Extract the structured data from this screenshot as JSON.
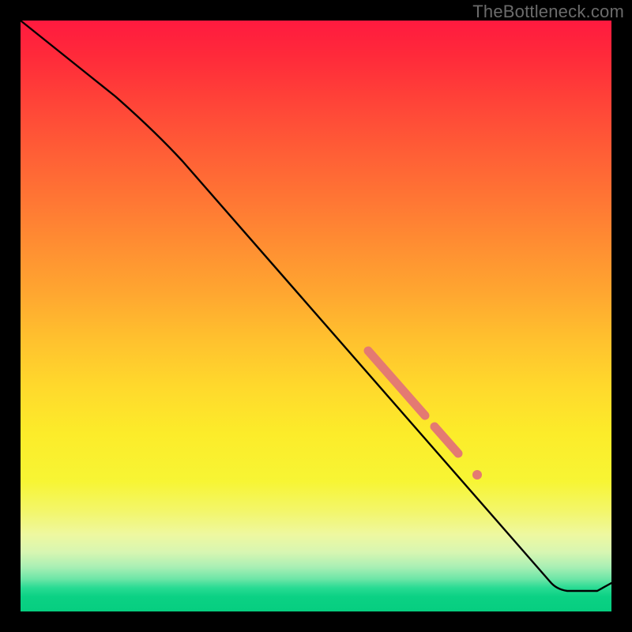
{
  "watermark": "TheBottleneck.com",
  "colors": {
    "highlight": "#e47a72",
    "curve": "#000000",
    "border": "#000000"
  },
  "chart_data": {
    "type": "line",
    "title": "",
    "xlabel": "",
    "ylabel": "",
    "xlim": [
      0,
      100
    ],
    "ylim": [
      0,
      100
    ],
    "grid": false,
    "legend": false,
    "series": [
      {
        "name": "curve",
        "x": [
          0,
          5,
          10,
          15,
          20,
          25,
          30,
          35,
          40,
          45,
          50,
          55,
          60,
          65,
          70,
          75,
          80,
          85,
          90,
          92,
          95,
          100
        ],
        "y": [
          100,
          96,
          92,
          88,
          84,
          80,
          75,
          69,
          62,
          56,
          50,
          44,
          38,
          32,
          26,
          20,
          14,
          8,
          3,
          2,
          2,
          3
        ]
      }
    ],
    "highlights": [
      {
        "type": "segment",
        "x_range": [
          57,
          66
        ]
      },
      {
        "type": "segment",
        "x_range": [
          68,
          72
        ]
      },
      {
        "type": "dot",
        "x": 75.5
      }
    ]
  }
}
